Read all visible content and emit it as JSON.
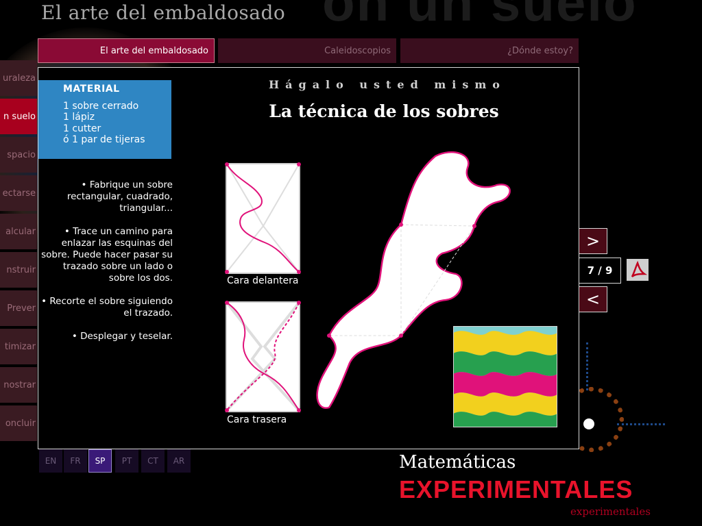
{
  "background_title": "on un suelo",
  "site_title": "El arte del embaldosado",
  "sidebar": {
    "items": [
      {
        "label": "uraleza",
        "active": false
      },
      {
        "label": "n suelo",
        "active": true
      },
      {
        "label": "spacio",
        "active": false
      },
      {
        "label": "ectarse",
        "active": false
      },
      {
        "label": "alcular",
        "active": false
      },
      {
        "label": "nstruir",
        "active": false
      },
      {
        "label": "Prever",
        "active": false
      },
      {
        "label": "timizar",
        "active": false
      },
      {
        "label": "nostrar",
        "active": false
      },
      {
        "label": "oncluir",
        "active": false
      }
    ]
  },
  "tabs": [
    {
      "label": "El arte del embaldosado",
      "active": true
    },
    {
      "label": "Caleidoscopios",
      "active": false
    },
    {
      "label": "¿Dónde estoy?",
      "active": false
    }
  ],
  "material": {
    "title": "MATERIAL",
    "items": [
      "1 sobre cerrado",
      "1 lápiz",
      "1 cutter",
      "ó 1 par de tijeras"
    ]
  },
  "steps": [
    "• Fabrique un sobre rectangular, cuadrado, triangular...",
    "• Trace un camino para enlazar las esquinas del sobre. Puede hacer pasar su trazado sobre un lado o sobre los dos.",
    "• Recorte el sobre siguiendo el trazado.",
    "• Desplegar y teselar."
  ],
  "kicker": "Hágalo usted mismo",
  "heading": "La técnica de los sobres",
  "captions": {
    "front": "Cara delantera",
    "back": "Cara trasera"
  },
  "pager": {
    "next": ">",
    "prev": "<",
    "current": "7 / 9",
    "pdf_icon": "pdf-icon"
  },
  "languages": [
    {
      "code": "EN",
      "active": false
    },
    {
      "code": "FR",
      "active": false
    },
    {
      "code": "SP",
      "active": true
    },
    {
      "code": "PT",
      "active": false
    },
    {
      "code": "CT",
      "active": false
    },
    {
      "code": "AR",
      "active": false
    }
  ],
  "brand": {
    "line1": "Matemáticas",
    "line2": "EXPERIMENTALES",
    "line3": "experimentales"
  },
  "colors": {
    "accent_red": "#a8001e",
    "magenta": "#e0127a",
    "material_blue": "#2f86c3"
  }
}
